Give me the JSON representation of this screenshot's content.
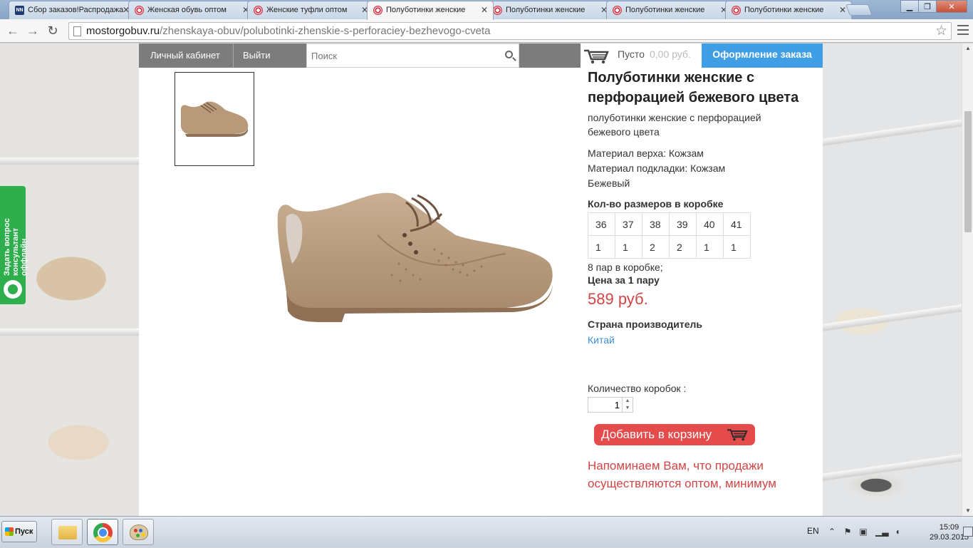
{
  "browser": {
    "tabs": [
      {
        "label": "Сбор заказов!Распродажа",
        "icon": "nn-favicon",
        "active": false
      },
      {
        "label": "Женская обувь оптом",
        "icon": "site-favicon",
        "active": false
      },
      {
        "label": "Женские туфли оптом",
        "icon": "site-favicon",
        "active": false
      },
      {
        "label": "Полуботинки женские",
        "icon": "site-favicon",
        "active": true
      },
      {
        "label": "Полуботинки женские",
        "icon": "site-favicon",
        "active": false
      },
      {
        "label": "Полуботинки женские",
        "icon": "site-favicon",
        "active": false
      },
      {
        "label": "Полуботинки женские",
        "icon": "site-favicon",
        "active": false
      }
    ],
    "nn_favicon_text": "NN",
    "url_host": "mostorgobuv.ru",
    "url_path": "/zhenskaya-obuv/polubotinki-zhenskie-s-perforaciey-bezhevogo-cveta"
  },
  "header": {
    "account_link": "Личный кабинет",
    "logout_link": "Выйти",
    "search_placeholder": "Поиск",
    "cart_status": "Пусто",
    "cart_sum": "0,00 руб.",
    "checkout_button": "Оформление заказа"
  },
  "side_widget": {
    "line1": "Задать вопрос",
    "line2": "консультант оффлайн"
  },
  "product": {
    "title": "Полуботинки женские с перфорацией бежевого цвета",
    "subtitle": "полуботинки женские с перфорацией бежевого цвета",
    "material_top": "Материал верха: Кожзам",
    "material_lining": "Материал подкладки: Кожзам",
    "color": "Бежевый",
    "sizes_title": "Кол-во размеров в коробке",
    "sizes": [
      "36",
      "37",
      "38",
      "39",
      "40",
      "41"
    ],
    "counts": [
      "1",
      "1",
      "2",
      "2",
      "1",
      "1"
    ],
    "pairs": "8 пар в коробке;",
    "price_label": "Цена за 1 пару",
    "price": "589 руб.",
    "country_label": "Страна производитель",
    "country": "Китай",
    "qty_label": "Количество коробок :",
    "qty_value": "1",
    "add_to_cart": "Добавить в корзину",
    "reminder": "Напоминаем Вам, что продажи осуществляются оптом, минимум"
  },
  "colors": {
    "accent_blue": "#3f9ee6",
    "price_red": "#d04545",
    "button_red": "#e54b4b",
    "widget_green": "#2fae4e",
    "header_gray": "#7c7c7c"
  },
  "taskbar": {
    "start_label": "Пуск",
    "language": "EN",
    "time": "15:09",
    "date": "29.03.2015"
  }
}
